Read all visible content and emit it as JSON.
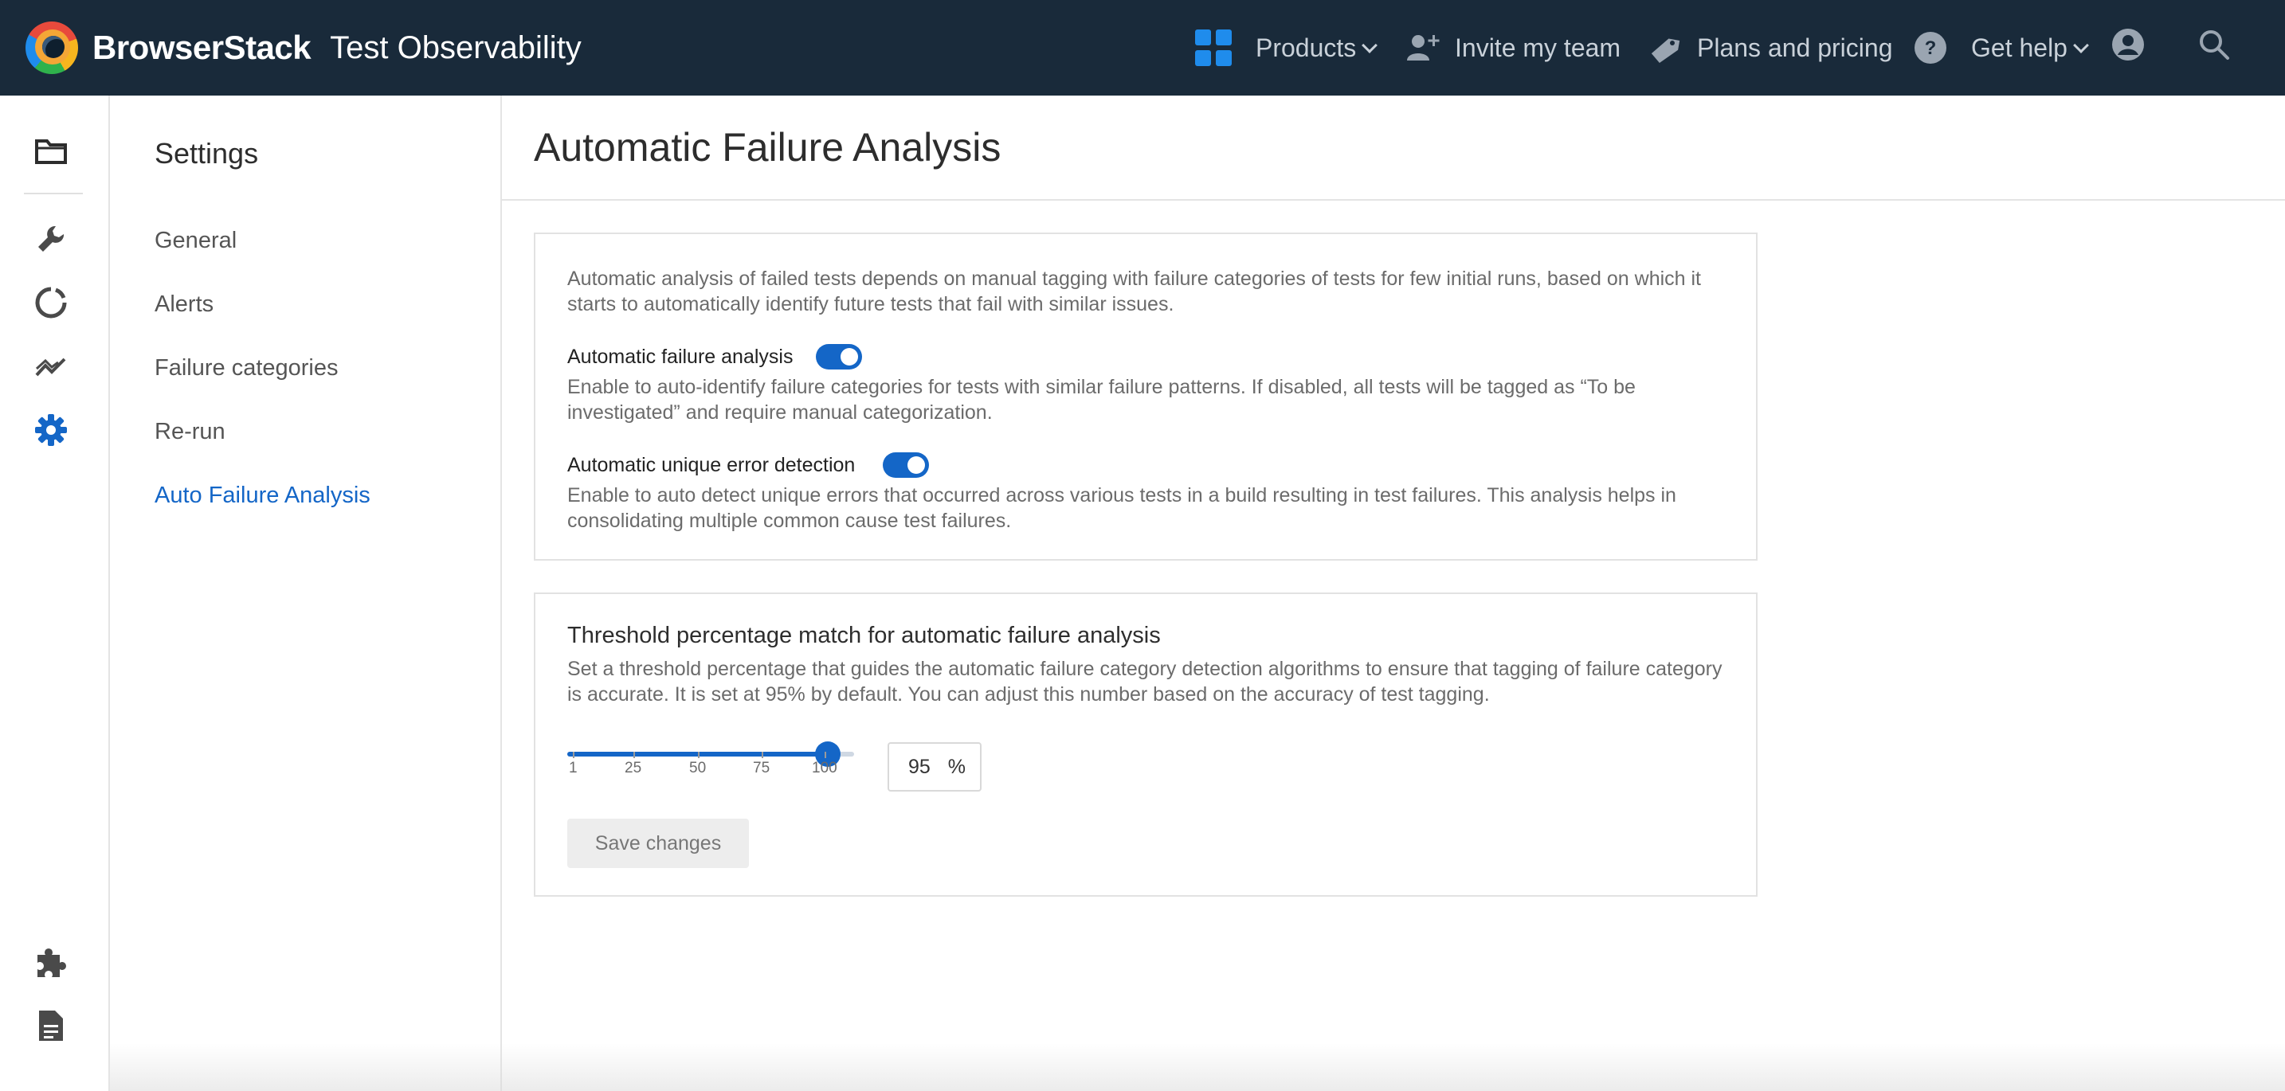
{
  "header": {
    "brand": "BrowserStack",
    "product": "Test Observability",
    "nav": {
      "products": "Products",
      "invite": "Invite my team",
      "plans": "Plans and pricing",
      "help": "Get help"
    },
    "colors": {
      "background": "#192a3a",
      "accent": "#1f8cec"
    }
  },
  "rail": {
    "icons": [
      "folder-icon",
      "wrench-icon",
      "loading-ring-icon",
      "trend-icon",
      "gear-icon",
      "puzzle-icon",
      "document-icon"
    ],
    "active": "gear-icon"
  },
  "settings": {
    "title": "Settings",
    "menu": [
      {
        "label": "General",
        "active": false
      },
      {
        "label": "Alerts",
        "active": false
      },
      {
        "label": "Failure categories",
        "active": false
      },
      {
        "label": "Re-run",
        "active": false
      },
      {
        "label": "Auto Failure Analysis",
        "active": true
      }
    ]
  },
  "main": {
    "title": "Automatic Failure Analysis",
    "card1": {
      "intro": "Automatic analysis of failed tests depends on manual tagging with failure categories of tests for few initial runs, based on which it starts to automatically identify future tests that fail with similar issues.",
      "auto_analysis": {
        "label": "Automatic failure analysis",
        "enabled": true,
        "description": "Enable to auto-identify failure categories for tests with similar failure patterns. If disabled, all tests will be tagged as “To be investigated” and require manual categorization."
      },
      "unique_error": {
        "label": "Automatic unique error detection",
        "enabled": true,
        "description": "Enable to auto detect unique errors that occurred across various tests in a build resulting in test failures. This analysis helps in consolidating multiple common cause test failures."
      }
    },
    "card2": {
      "heading": "Threshold percentage match for automatic failure analysis",
      "description": "Set a threshold percentage that guides the automatic failure category detection algorithms to ensure that tagging of failure category is accurate. It is set at 95% by default. You can adjust this number based on the accuracy of test tagging.",
      "slider": {
        "min": 1,
        "max": 100,
        "value": 95,
        "ticks": [
          "1",
          "25",
          "50",
          "75",
          "100"
        ]
      },
      "value_input": "95",
      "unit": "%",
      "save_label": "Save changes"
    },
    "colors": {
      "accent": "#1466c7"
    }
  }
}
